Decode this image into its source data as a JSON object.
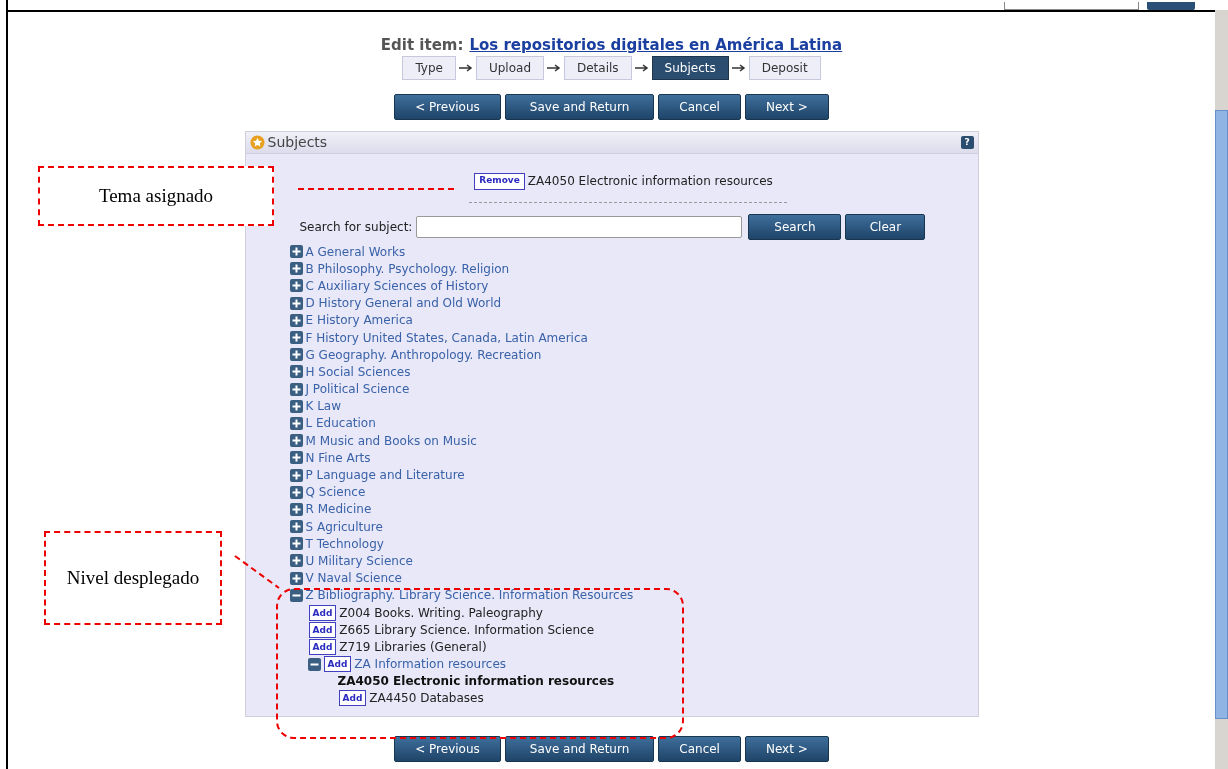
{
  "heading": {
    "label": "Edit item:",
    "title": "Los repositorios digitales en América Latina"
  },
  "steps": [
    {
      "label": "Type",
      "selected": false
    },
    {
      "label": "Upload",
      "selected": false
    },
    {
      "label": "Details",
      "selected": false
    },
    {
      "label": "Subjects",
      "selected": true
    },
    {
      "label": "Deposit",
      "selected": false
    }
  ],
  "buttons_top": [
    "< Previous",
    "Save and Return",
    "Cancel",
    "Next >"
  ],
  "panel": {
    "title": "Subjects",
    "help": "?",
    "assigned": [
      {
        "button": "Remove",
        "label": "ZA4050 Electronic information resources"
      }
    ],
    "search": {
      "label": "Search for subject:",
      "search_button": "Search",
      "clear_button": "Clear"
    },
    "tree": [
      {
        "kind": "branch",
        "label": "A General Works",
        "expanded": false
      },
      {
        "kind": "branch",
        "label": "B Philosophy. Psychology. Religion",
        "expanded": false
      },
      {
        "kind": "branch",
        "label": "C Auxiliary Sciences of History",
        "expanded": false
      },
      {
        "kind": "branch",
        "label": "D History General and Old World",
        "expanded": false
      },
      {
        "kind": "branch",
        "label": "E History America",
        "expanded": false
      },
      {
        "kind": "branch",
        "label": "F History United States, Canada, Latin America",
        "expanded": false
      },
      {
        "kind": "branch",
        "label": "G Geography. Anthropology. Recreation",
        "expanded": false
      },
      {
        "kind": "branch",
        "label": "H Social Sciences",
        "expanded": false
      },
      {
        "kind": "branch",
        "label": "J Political Science",
        "expanded": false
      },
      {
        "kind": "branch",
        "label": "K Law",
        "expanded": false
      },
      {
        "kind": "branch",
        "label": "L Education",
        "expanded": false
      },
      {
        "kind": "branch",
        "label": "M Music and Books on Music",
        "expanded": false
      },
      {
        "kind": "branch",
        "label": "N Fine Arts",
        "expanded": false
      },
      {
        "kind": "branch",
        "label": "P Language and Literature",
        "expanded": false
      },
      {
        "kind": "branch",
        "label": "Q Science",
        "expanded": false
      },
      {
        "kind": "branch",
        "label": "R Medicine",
        "expanded": false
      },
      {
        "kind": "branch",
        "label": "S Agriculture",
        "expanded": false
      },
      {
        "kind": "branch",
        "label": "T Technology",
        "expanded": false
      },
      {
        "kind": "branch",
        "label": "U Military Science",
        "expanded": false
      },
      {
        "kind": "branch",
        "label": "V Naval Science",
        "expanded": false
      },
      {
        "kind": "branch",
        "label": "Z Bibliography. Library Science. Information Resources",
        "expanded": true,
        "children": [
          {
            "kind": "leaf",
            "add": "Add",
            "label": "Z004 Books. Writing. Paleography"
          },
          {
            "kind": "leaf",
            "add": "Add",
            "label": "Z665 Library Science. Information Science"
          },
          {
            "kind": "leaf",
            "add": "Add",
            "label": "Z719 Libraries (General)"
          },
          {
            "kind": "branch_add",
            "add": "Add",
            "label": "ZA Information resources",
            "expanded": true,
            "children": [
              {
                "kind": "assigned",
                "label": "ZA4050 Electronic information resources"
              },
              {
                "kind": "leaf",
                "add": "Add",
                "label": "ZA4450 Databases"
              }
            ]
          }
        ]
      }
    ]
  },
  "buttons_bottom": [
    "< Previous",
    "Save and Return",
    "Cancel",
    "Next >"
  ],
  "annotations": [
    {
      "kind": "assigned_note",
      "text": "Tema asignado"
    },
    {
      "kind": "expanded_note",
      "text": "Nivel desplegado"
    }
  ]
}
